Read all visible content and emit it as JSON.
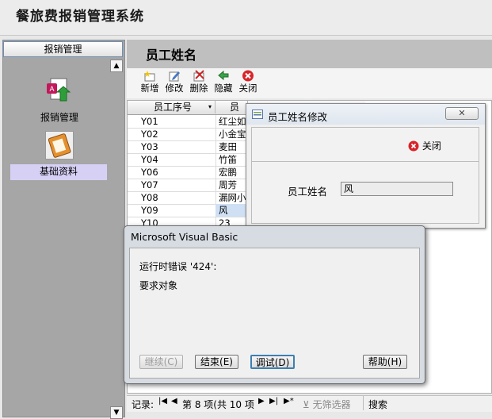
{
  "app": {
    "title": "餐旅费报销管理系统"
  },
  "nav": {
    "header": "报销管理",
    "items": [
      {
        "label": "报销管理"
      },
      {
        "label": "基础资料"
      }
    ]
  },
  "form": {
    "title": "员工姓名",
    "toolbar": {
      "add": "新增",
      "edit": "修改",
      "delete": "删除",
      "hide": "隐藏",
      "close": "关闭"
    },
    "columns": [
      "员工序号",
      "员工姓名"
    ],
    "rows": [
      {
        "id": "Y01",
        "name": "红尘如"
      },
      {
        "id": "Y02",
        "name": "小金宝"
      },
      {
        "id": "Y03",
        "name": "麦田"
      },
      {
        "id": "Y04",
        "name": "竹笛"
      },
      {
        "id": "Y06",
        "name": "宏鹏"
      },
      {
        "id": "Y07",
        "name": "周芳"
      },
      {
        "id": "Y08",
        "name": "漏网小"
      },
      {
        "id": "Y09",
        "name": "风"
      },
      {
        "id": "Y10",
        "name": "23"
      }
    ],
    "record_nav": {
      "label": "记录:",
      "position": "第 8 项(共 10 项",
      "filter": "无筛选器",
      "search": "搜索"
    }
  },
  "edit_dialog": {
    "title": "员工姓名修改",
    "close_label": "关闭",
    "field_label": "员工姓名",
    "field_value": "风"
  },
  "error_dialog": {
    "title": "Microsoft Visual Basic",
    "message": "运行时错误 '424':",
    "detail": "要求对象",
    "buttons": {
      "continue": "继续(C)",
      "end": "结束(E)",
      "debug": "调试(D)",
      "help": "帮助(H)"
    }
  }
}
